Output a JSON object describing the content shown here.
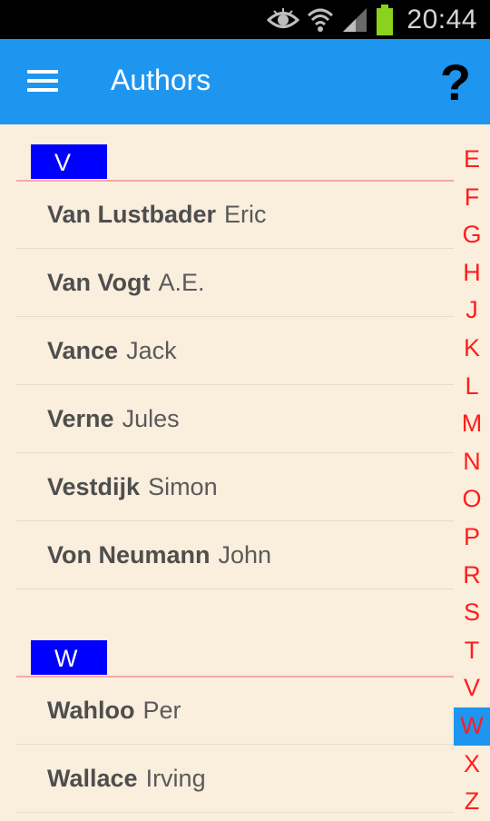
{
  "status_bar": {
    "time": "20:44"
  },
  "app_bar": {
    "title": "Authors",
    "help_label": "?"
  },
  "sections": [
    {
      "letter": "V",
      "authors": [
        {
          "last": "Van Lustbader",
          "first": "Eric"
        },
        {
          "last": "Van Vogt",
          "first": "A.E."
        },
        {
          "last": "Vance",
          "first": "Jack"
        },
        {
          "last": "Verne",
          "first": "Jules"
        },
        {
          "last": "Vestdijk",
          "first": "Simon"
        },
        {
          "last": "Von Neumann",
          "first": "John"
        }
      ]
    },
    {
      "letter": "W",
      "authors": [
        {
          "last": "Wahloo",
          "first": "Per"
        },
        {
          "last": "Wallace",
          "first": "Irving"
        }
      ]
    }
  ],
  "index": {
    "letters": [
      "E",
      "F",
      "G",
      "H",
      "J",
      "K",
      "L",
      "M",
      "N",
      "O",
      "P",
      "R",
      "S",
      "T",
      "V",
      "W",
      "X",
      "Z"
    ],
    "active": "W"
  },
  "colors": {
    "app_bar": "#1e96f0",
    "background": "#faeedd",
    "section_header": "#0000ff",
    "index_letter": "#ff1e1e"
  }
}
